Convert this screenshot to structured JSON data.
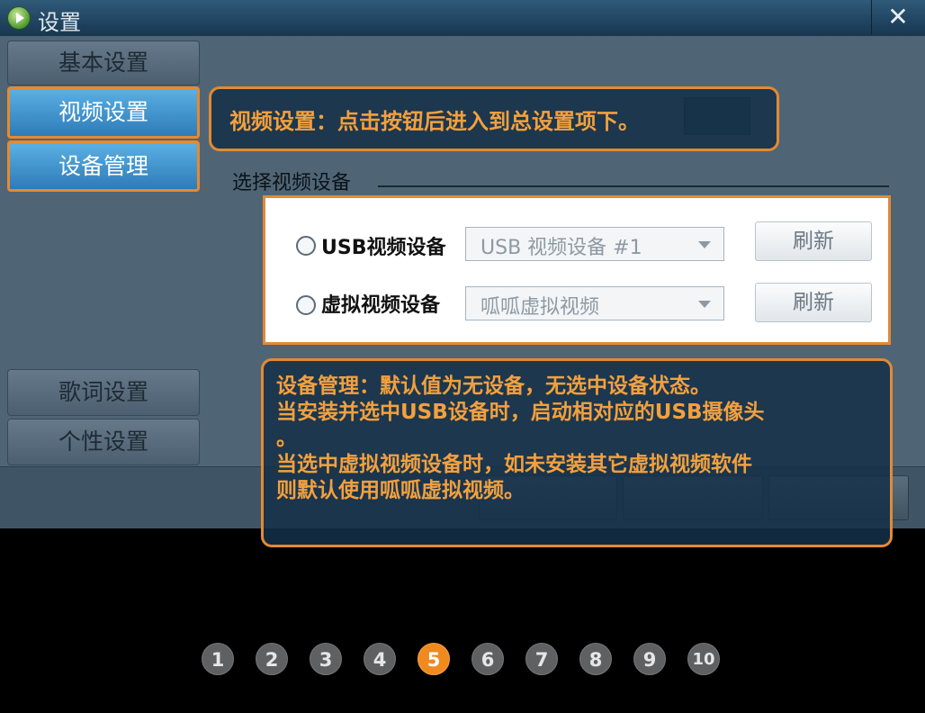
{
  "window": {
    "title": "设置",
    "close_label": "✕"
  },
  "sidebar": {
    "items": [
      {
        "label": "基本设置",
        "active": false
      },
      {
        "label": "视频设置",
        "active": true
      },
      {
        "label": "设备管理",
        "active": true
      },
      {
        "label": "歌词设置",
        "active": false
      },
      {
        "label": "个性设置",
        "active": false
      }
    ]
  },
  "main": {
    "group_label": "选择视频设备",
    "devices": [
      {
        "label": "USB视频设备",
        "selected_value": "USB 视频设备 #1",
        "refresh_label": "刷新"
      },
      {
        "label": "虚拟视频设备",
        "selected_value": "呱呱虚拟视频",
        "refresh_label": "刷新"
      }
    ]
  },
  "callouts": {
    "video": "视频设置：点击按钮后进入到总设置项下。",
    "device": [
      "设备管理：默认值为无设备，无选中设备状态。",
      "当安装并选中USB设备时，启动相对应的USB摄像头",
      "。",
      "当选中虚拟视频设备时，如未安装其它虚拟视频软件",
      "则默认使用呱呱虚拟视频。"
    ]
  },
  "pager": {
    "pages": [
      "1",
      "2",
      "3",
      "4",
      "5",
      "6",
      "7",
      "8",
      "9",
      "10"
    ],
    "current": "5"
  },
  "colors": {
    "accent": "#e38a33",
    "callout_text": "#f3a03e",
    "active_tab": "#3a8ccc"
  }
}
